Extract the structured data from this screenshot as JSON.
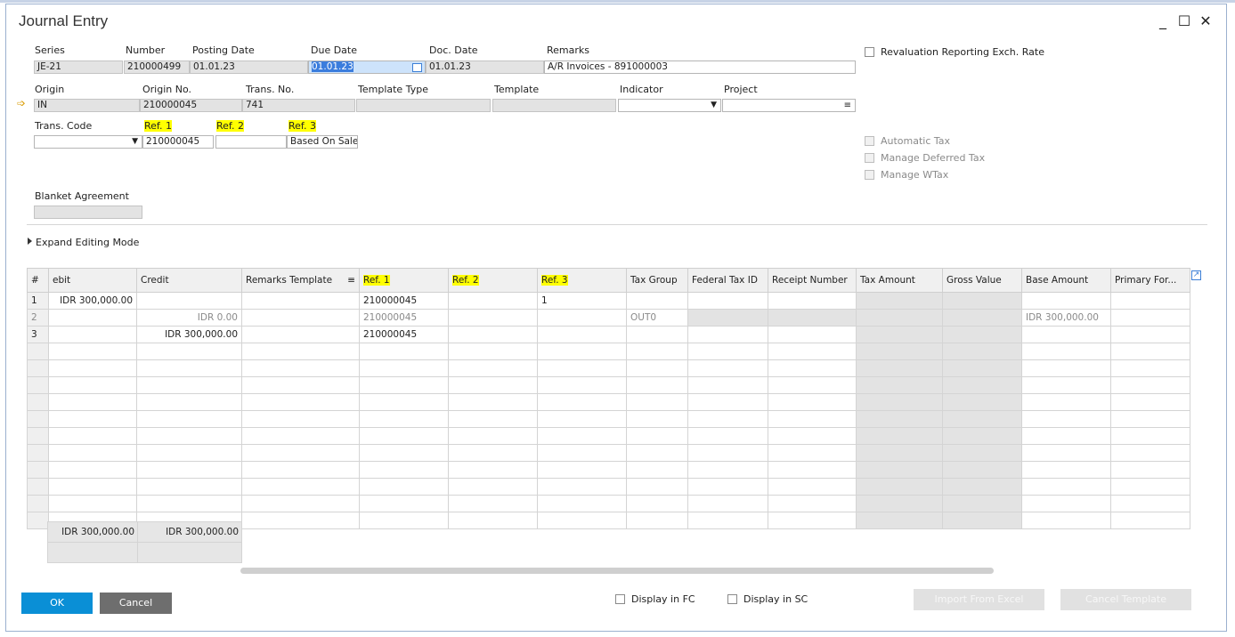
{
  "window": {
    "title": "Journal Entry",
    "minimize": "_",
    "maximize": "☐",
    "close": "✕"
  },
  "header": {
    "series_label": "Series",
    "series_value": "JE-21",
    "number_label": "Number",
    "number_value": "210000499",
    "posting_date_label": "Posting Date",
    "posting_date_value": "01.01.23",
    "due_date_label": "Due Date",
    "due_date_value": "01.01.23",
    "doc_date_label": "Doc. Date",
    "doc_date_value": "01.01.23",
    "remarks_label": "Remarks",
    "remarks_value": "A/R Invoices - 891000003",
    "origin_label": "Origin",
    "origin_value": "IN",
    "origin_no_label": "Origin No.",
    "origin_no_value": "210000045",
    "trans_no_label": "Trans. No.",
    "trans_no_value": "741",
    "template_type_label": "Template Type",
    "template_type_value": "",
    "template_label": "Template",
    "template_value": "",
    "indicator_label": "Indicator",
    "indicator_value": "",
    "project_label": "Project",
    "project_value": "",
    "trans_code_label": "Trans. Code",
    "trans_code_value": "",
    "ref1_label": "Ref. 1",
    "ref1_value": "210000045",
    "ref2_label": "Ref. 2",
    "ref2_value": "",
    "ref3_label": "Ref. 3",
    "ref3_value": "Based On Sale",
    "blanket_label": "Blanket Agreement",
    "blanket_value": ""
  },
  "options": {
    "revaluation": "Revaluation Reporting Exch. Rate",
    "automatic_tax": "Automatic Tax",
    "manage_deferred_tax": "Manage Deferred Tax",
    "manage_wtax": "Manage WTax"
  },
  "expand_editing_mode": "Expand Editing Mode",
  "grid": {
    "columns": [
      "#",
      "ebit",
      "Credit",
      "Remarks Template",
      "Ref. 1",
      "Ref. 2",
      "Ref. 3",
      "Tax Group",
      "Federal Tax ID",
      "Receipt Number",
      "Tax Amount",
      "Gross Value",
      "Base Amount",
      "Primary For..."
    ],
    "rows": [
      [
        "1",
        "IDR 300,000.00",
        "",
        "",
        "210000045",
        "",
        "1",
        "",
        "",
        "",
        "",
        "",
        "",
        ""
      ],
      [
        "2",
        "",
        "IDR 0.00",
        "",
        "210000045",
        "",
        "",
        "OUT0",
        "",
        "",
        "",
        "",
        "IDR 300,000.00",
        ""
      ],
      [
        "3",
        "",
        "IDR 300,000.00",
        "",
        "210000045",
        "",
        "",
        "",
        "",
        "",
        "",
        "",
        "",
        ""
      ]
    ],
    "totals": {
      "debit": "IDR 300,000.00",
      "credit": "IDR 300,000.00"
    }
  },
  "footer": {
    "ok": "OK",
    "cancel": "Cancel",
    "display_fc": "Display in FC",
    "display_sc": "Display in SC",
    "import_excel": "Import From Excel",
    "cancel_template": "Cancel Template"
  },
  "colors": {
    "ok_button": "#0a8fd6",
    "highlight": "#ffff00",
    "selection": "#3b7ddd"
  }
}
